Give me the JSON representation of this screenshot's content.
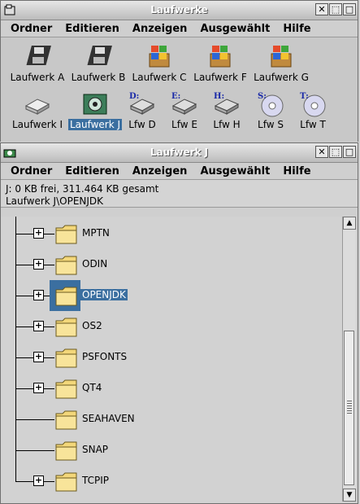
{
  "win1": {
    "title": "Laufwerke",
    "menu": [
      "Ordner",
      "Editieren",
      "Anzeigen",
      "Ausgewählt",
      "Hilfe"
    ],
    "drives_row1": [
      {
        "label": "Laufwerk A",
        "icon": "floppy-icon"
      },
      {
        "label": "Laufwerk B",
        "icon": "floppy-icon"
      },
      {
        "label": "Laufwerk C",
        "icon": "windows-drive-icon"
      },
      {
        "label": "Laufwerk F",
        "icon": "windows-drive-icon"
      },
      {
        "label": "Laufwerk G",
        "icon": "windows-drive-icon"
      }
    ],
    "drives_row2": [
      {
        "label": "Laufwerk I",
        "icon": "removable-drive-icon"
      },
      {
        "label": "Laufwerk J",
        "icon": "zip-drive-icon",
        "selected": true
      },
      {
        "label": "Lfw D",
        "icon": "network-drive-icon",
        "letter": "D:"
      },
      {
        "label": "Lfw E",
        "icon": "network-drive-icon",
        "letter": "E:"
      },
      {
        "label": "Lfw H",
        "icon": "network-drive-icon",
        "letter": "H:"
      },
      {
        "label": "Lfw S",
        "icon": "cd-icon",
        "letter": "S:"
      },
      {
        "label": "Lfw T",
        "icon": "cd-icon",
        "letter": "T:"
      }
    ]
  },
  "win2": {
    "title": "Laufwerk J",
    "menu": [
      "Ordner",
      "Editieren",
      "Anzeigen",
      "Ausgewählt",
      "Hilfe"
    ],
    "info_line1": "J:  0 KB frei,  311.464 KB gesamt",
    "info_line2": "Laufwerk J\\OPENJDK",
    "folders": [
      {
        "name": "MPTN",
        "expandable": true
      },
      {
        "name": "ODIN",
        "expandable": true
      },
      {
        "name": "OPENJDK",
        "expandable": true,
        "selected": true
      },
      {
        "name": "OS2",
        "expandable": true
      },
      {
        "name": "PSFONTS",
        "expandable": true
      },
      {
        "name": "QT4",
        "expandable": true
      },
      {
        "name": "SEAHAVEN",
        "expandable": false
      },
      {
        "name": "SNAP",
        "expandable": false
      },
      {
        "name": "TCPIP",
        "expandable": true
      }
    ]
  },
  "colors": {
    "selection": "#3b6fa0",
    "folder": "#f3d77a"
  }
}
